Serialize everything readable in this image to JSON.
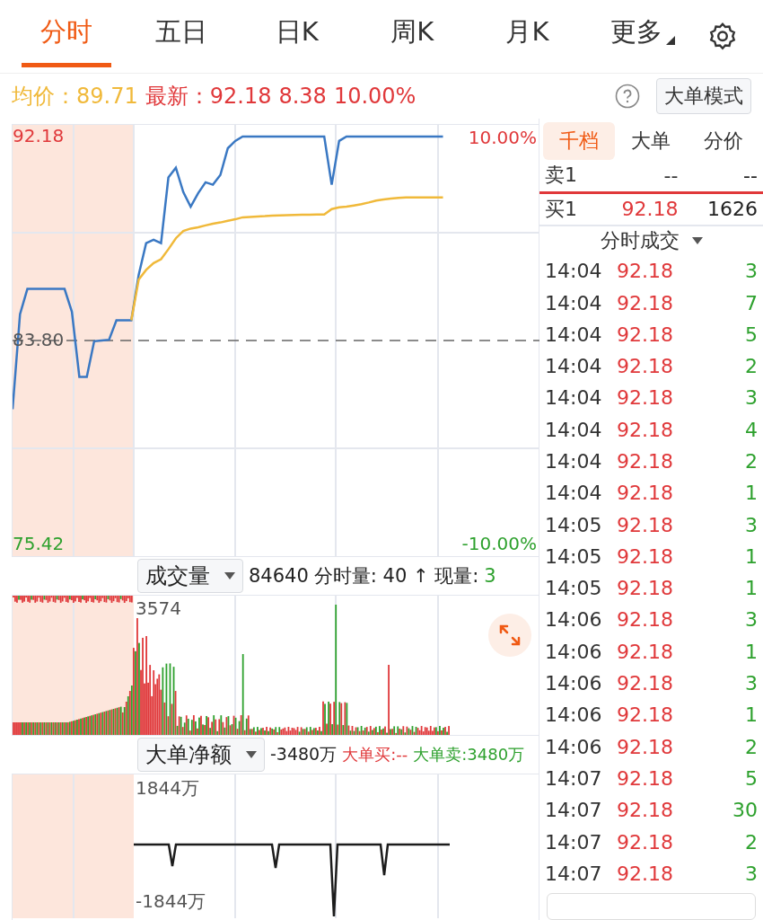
{
  "tabs": [
    {
      "label": "分时",
      "selected": true
    },
    {
      "label": "五日",
      "selected": false
    },
    {
      "label": "日K",
      "selected": false
    },
    {
      "label": "周K",
      "selected": false
    },
    {
      "label": "月K",
      "selected": false
    },
    {
      "label": "更多",
      "selected": false,
      "kind": "menu"
    }
  ],
  "quote": {
    "avg_label": "均价：",
    "avg": "89.71",
    "last_label": "最新：",
    "last": "92.18",
    "change": "8.38",
    "change_pct": "10.00%",
    "mode_button": "大单模式"
  },
  "price_chart": {
    "high_pct": "10.00%",
    "low_pct": "-10.00%",
    "chart_data": {
      "type": "line",
      "categories": [
        null,
        null,
        null,
        null,
        null,
        null,
        null,
        null,
        null,
        null,
        null,
        null,
        null,
        null,
        null,
        null,
        null,
        null,
        null,
        null,
        null,
        null,
        null,
        null,
        null,
        null,
        null,
        null,
        null,
        null,
        null,
        null,
        null,
        null,
        null,
        null,
        null,
        null,
        null,
        null,
        null,
        null,
        null,
        null,
        null,
        null,
        null,
        null,
        null,
        null,
        null,
        null,
        null,
        null,
        null,
        null,
        null,
        null,
        null,
        null,
        null,
        null,
        null,
        null,
        null,
        null,
        null,
        null,
        null,
        null,
        null,
        null
      ],
      "ylim": [
        74.94,
        92.66
      ],
      "yticks": [
        {
          "value": 75.42,
          "label": "75.42"
        },
        {
          "value": 83.8,
          "label": "83.80"
        },
        {
          "value": 92.18,
          "label": "92.18"
        }
      ],
      "series": [
        {
          "color": "#666666",
          "line_style": "dashed",
          "values": [
            83.8,
            83.8,
            83.8,
            83.8,
            83.8,
            83.8,
            83.8,
            83.8,
            83.8,
            83.8,
            83.8,
            83.8,
            83.8,
            83.8,
            83.8,
            83.8,
            83.8,
            83.8,
            83.8,
            83.8,
            83.8,
            83.8,
            83.8,
            83.8,
            83.8,
            83.8,
            83.8,
            83.8,
            83.8,
            83.8,
            83.8,
            83.8,
            83.8,
            83.8,
            83.8,
            83.8,
            83.8,
            83.8,
            83.8,
            83.8,
            83.8,
            83.8,
            83.8,
            83.8,
            83.8,
            83.8,
            83.8,
            83.8,
            83.8,
            83.8,
            83.8,
            83.8,
            83.8,
            83.8,
            83.8,
            83.8,
            83.8,
            83.8,
            83.8,
            83.8,
            83.8,
            83.8,
            83.8,
            83.8,
            83.8,
            83.8,
            83.8,
            83.8,
            83.8,
            83.8,
            83.8,
            83.8
          ]
        },
        {
          "color": "#3a78c3",
          "values": [
            80.98,
            84.88,
            85.92,
            85.92,
            85.92,
            85.92,
            85.92,
            85.92,
            84.98,
            82.31,
            82.31,
            83.77,
            83.8,
            83.83,
            84.63,
            84.63,
            84.63,
            86.5,
            87.8,
            87.94,
            87.8,
            90.5,
            90.9,
            89.9,
            89.3,
            89.85,
            90.3,
            90.2,
            90.6,
            91.7,
            92.0,
            92.18,
            92.18,
            92.18,
            92.18,
            92.18,
            92.18,
            92.18,
            92.18,
            92.18,
            92.18,
            92.18,
            92.18,
            90.2,
            92.0,
            92.18,
            92.18,
            92.18,
            92.18,
            92.18,
            92.18,
            92.18,
            92.18,
            92.18,
            92.18,
            92.18,
            92.18,
            92.18,
            92.18,
            null,
            null,
            null,
            null,
            null,
            null,
            null,
            null,
            null,
            null,
            null,
            null,
            null
          ]
        },
        {
          "color": "#f0b93a",
          "values": [
            null,
            null,
            null,
            null,
            null,
            null,
            null,
            null,
            null,
            null,
            null,
            null,
            null,
            null,
            null,
            null,
            84.63,
            86.3,
            86.7,
            86.98,
            87.14,
            87.55,
            88.0,
            88.3,
            88.4,
            88.45,
            88.53,
            88.6,
            88.65,
            88.72,
            88.78,
            88.86,
            88.88,
            88.9,
            88.91,
            88.93,
            88.94,
            88.95,
            88.96,
            88.97,
            88.97,
            88.98,
            88.98,
            89.2,
            89.27,
            89.3,
            89.35,
            89.4,
            89.47,
            89.55,
            89.6,
            89.63,
            89.66,
            89.68,
            89.68,
            89.68,
            89.68,
            89.68,
            89.68,
            null,
            null,
            null,
            null,
            null,
            null,
            null,
            null,
            null,
            null,
            null,
            null,
            null
          ]
        }
      ]
    }
  },
  "volume": {
    "selector": "成交量",
    "total": "84640",
    "detail": "分时量: 40 ↑ 现量: ",
    "current": "3",
    "max": "3574"
  },
  "net_amount": {
    "selector": "大单净额",
    "total": "-3480万",
    "buy": "大单买:--",
    "sell": "大单卖:3480万",
    "max": "1844万",
    "min": "-1844万"
  },
  "side_tabs": [
    {
      "label": "千档",
      "selected": true
    },
    {
      "label": "大单",
      "selected": false
    },
    {
      "label": "分价",
      "selected": false
    }
  ],
  "order_book": [
    {
      "kind": "sell",
      "label": "卖1",
      "price": "--",
      "volume": "--"
    },
    {
      "kind": "buy",
      "label": "买1",
      "price": "92.18",
      "volume": "1626"
    }
  ],
  "trades_selector": "分时成交",
  "trades": [
    {
      "time": "14:04",
      "price": "92.18",
      "volume": "3"
    },
    {
      "time": "14:04",
      "price": "92.18",
      "volume": "7"
    },
    {
      "time": "14:04",
      "price": "92.18",
      "volume": "5"
    },
    {
      "time": "14:04",
      "price": "92.18",
      "volume": "2"
    },
    {
      "time": "14:04",
      "price": "92.18",
      "volume": "3"
    },
    {
      "time": "14:04",
      "price": "92.18",
      "volume": "4"
    },
    {
      "time": "14:04",
      "price": "92.18",
      "volume": "2"
    },
    {
      "time": "14:04",
      "price": "92.18",
      "volume": "1"
    },
    {
      "time": "14:05",
      "price": "92.18",
      "volume": "3"
    },
    {
      "time": "14:05",
      "price": "92.18",
      "volume": "1"
    },
    {
      "time": "14:05",
      "price": "92.18",
      "volume": "1"
    },
    {
      "time": "14:06",
      "price": "92.18",
      "volume": "3"
    },
    {
      "time": "14:06",
      "price": "92.18",
      "volume": "1"
    },
    {
      "time": "14:06",
      "price": "92.18",
      "volume": "3"
    },
    {
      "time": "14:06",
      "price": "92.18",
      "volume": "1"
    },
    {
      "time": "14:06",
      "price": "92.18",
      "volume": "2"
    },
    {
      "time": "14:07",
      "price": "92.18",
      "volume": "5"
    },
    {
      "time": "14:07",
      "price": "92.18",
      "volume": "30"
    },
    {
      "time": "14:07",
      "price": "92.18",
      "volume": "2"
    },
    {
      "time": "14:07",
      "price": "92.18",
      "volume": "3"
    }
  ]
}
